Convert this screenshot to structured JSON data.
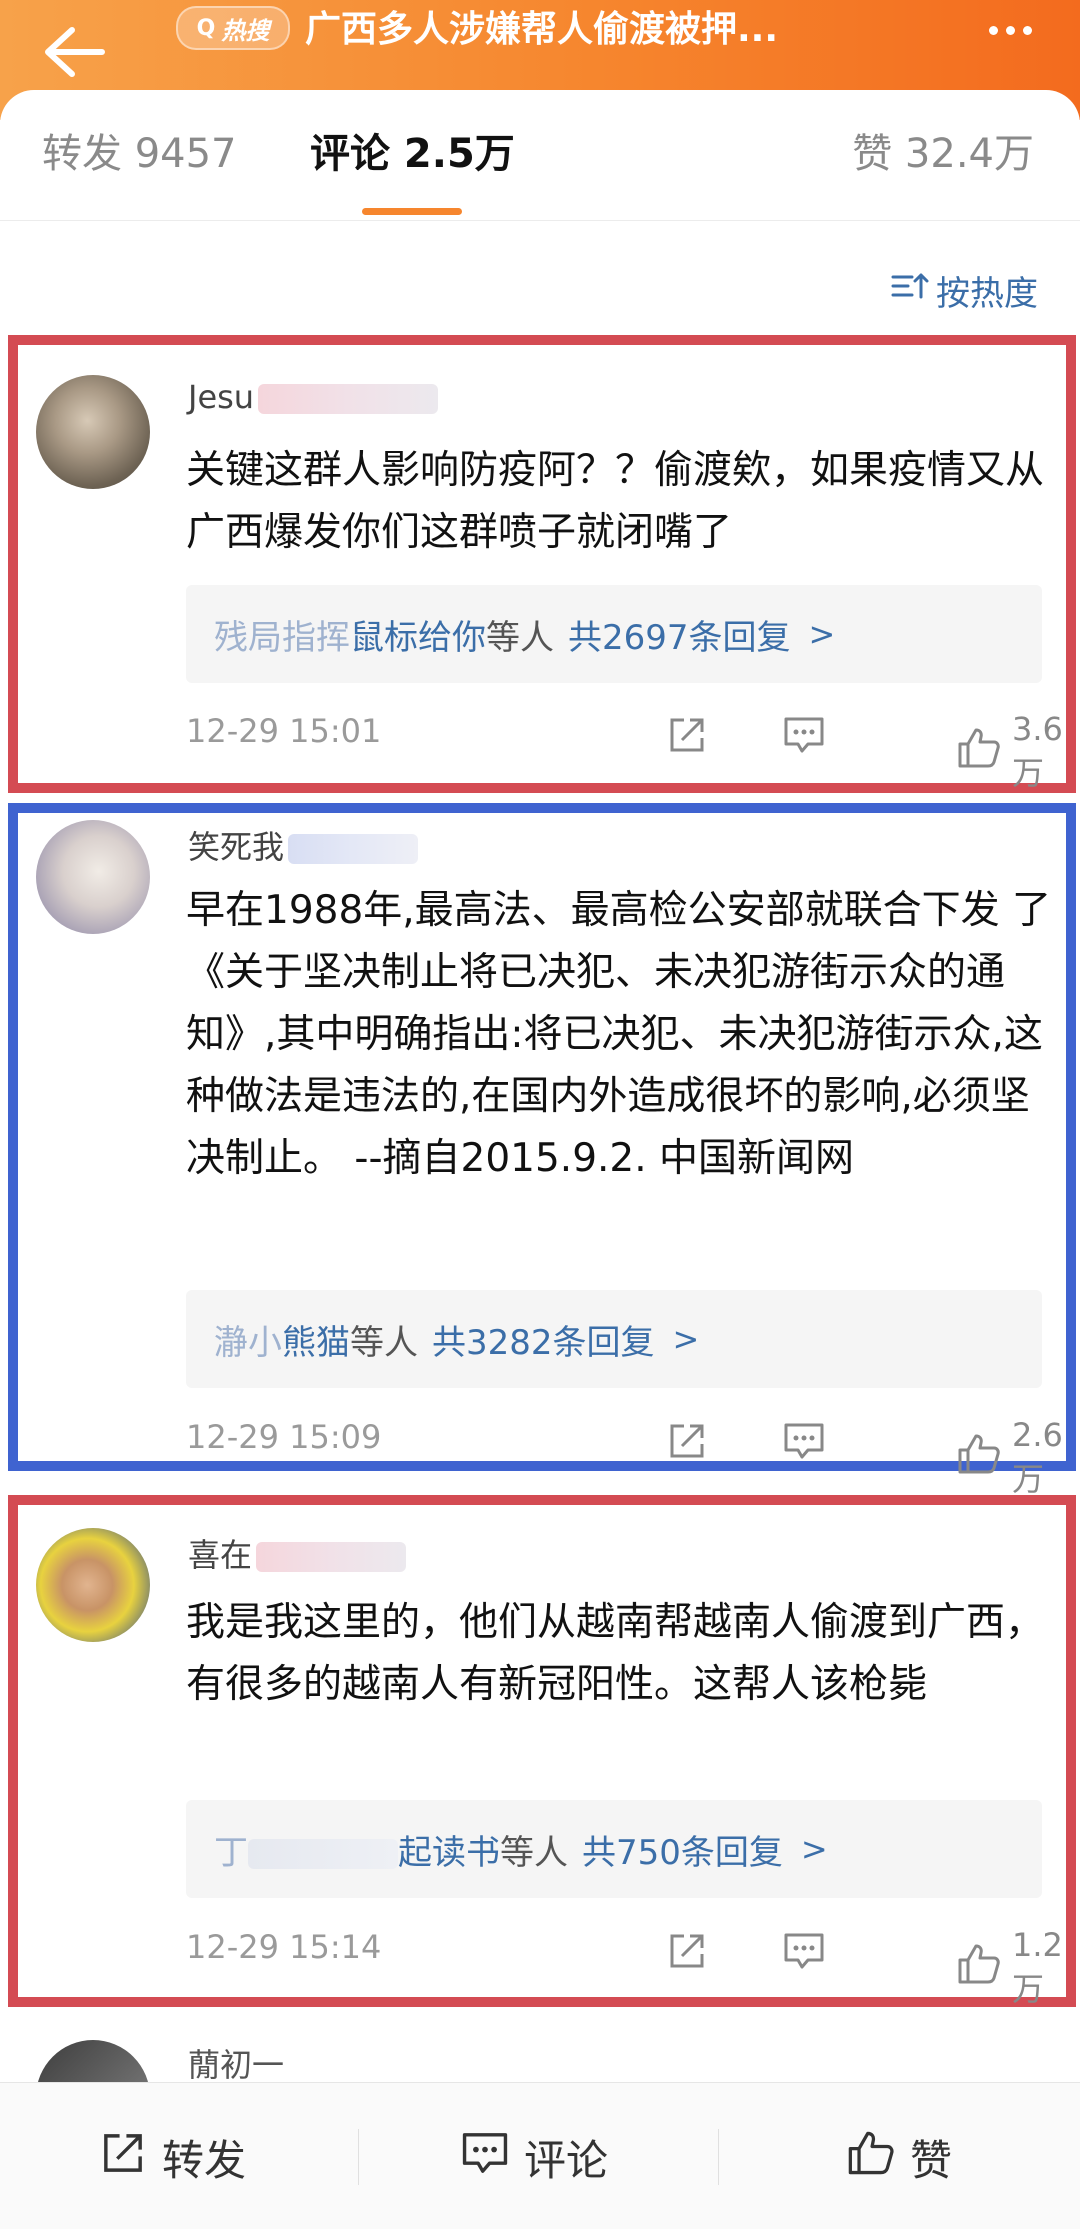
{
  "header": {
    "hot_label": "热搜",
    "title": "广西多人涉嫌帮人偷渡被押..."
  },
  "tabs": {
    "repost": "转发 9457",
    "comment": "评论 2.5万",
    "like": "赞 32.4万"
  },
  "sort": {
    "label": "按热度"
  },
  "comments": [
    {
      "username_visible": "Jesu",
      "text": "关键这群人影响防疫阿？？偷渡欸，如果疫情又从广西爆发你们这群喷子就闭嘴了",
      "reply_names_obscured": "残局指挥",
      "reply_names_visible": "鼠标给你",
      "reply_suffix": "等人",
      "reply_count": "共2697条回复",
      "time": "12-29 15:01",
      "likes": "3.6万"
    },
    {
      "username_visible": "笑死我",
      "text": "早在1988年,最高法、最高检公安部就联合下发 了《关于坚决制止将已决犯、未决犯游街示众的通知》,其中明确指出:将已决犯、未决犯游街示众,这种做法是违法的,在国内外造成很坏的影响,必须坚决制止。 --摘自2015.9.2. 中国新闻网",
      "reply_names_obscured": "瀞小",
      "reply_names_visible": "熊猫",
      "reply_suffix": "等人",
      "reply_count": "共3282条回复",
      "time": "12-29 15:09",
      "likes": "2.6万"
    },
    {
      "username_visible": "喜在",
      "text": "我是我这里的，他们从越南帮越南人偷渡到广西，有很多的越南人有新冠阳性。这帮人该枪毙",
      "reply_names_obscured": "丁",
      "reply_names_visible": "起读书",
      "reply_suffix": "等人",
      "reply_count": "共750条回复",
      "time": "12-29 15:14",
      "likes": "1.2万"
    }
  ],
  "next_comment": {
    "username_visible": "蕑初一"
  },
  "bottom_bar": {
    "repost": "转发",
    "comment": "评论",
    "like": "赞"
  },
  "colors": {
    "header_orange": "#f6862e",
    "highlight_red": "#d44b53",
    "highlight_blue": "#3f63d0",
    "link_blue": "#3b6ea8"
  }
}
